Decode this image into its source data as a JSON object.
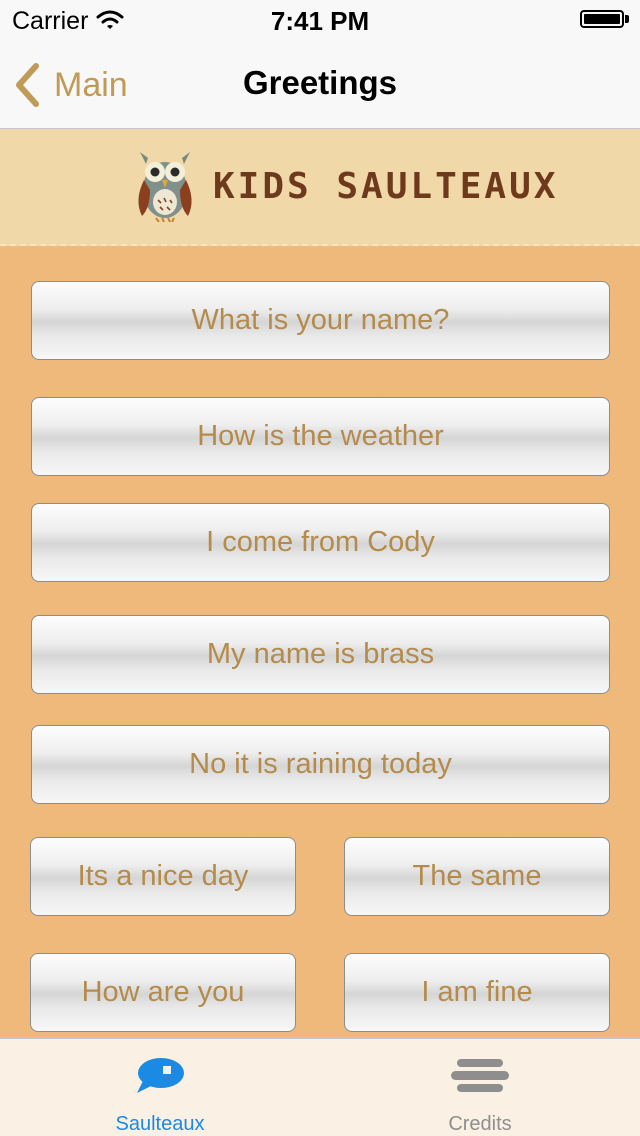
{
  "status_bar": {
    "carrier": "Carrier",
    "time": "7:41 PM"
  },
  "nav_bar": {
    "back_label": "Main",
    "title": "Greetings"
  },
  "banner": {
    "logo_text": "KIDS SAULTEAUX"
  },
  "phrases": [
    "What is your name?",
    "How is the weather",
    "I come from Cody",
    "My name is brass",
    "No it is raining today",
    "Its a nice day",
    "The same",
    "How are you",
    "I am fine"
  ],
  "tab_bar": {
    "tabs": [
      {
        "label": "Saulteaux",
        "icon": "speech-bubble-icon",
        "active": true
      },
      {
        "label": "Credits",
        "icon": "stack-icon",
        "active": false
      }
    ]
  },
  "colors": {
    "accent": "#c09a57",
    "background": "#efb97b",
    "banner": "#f0d8a8",
    "button_text": "#b58b4b",
    "tab_active": "#1a8ae5",
    "tab_inactive": "#8e8e8e"
  }
}
